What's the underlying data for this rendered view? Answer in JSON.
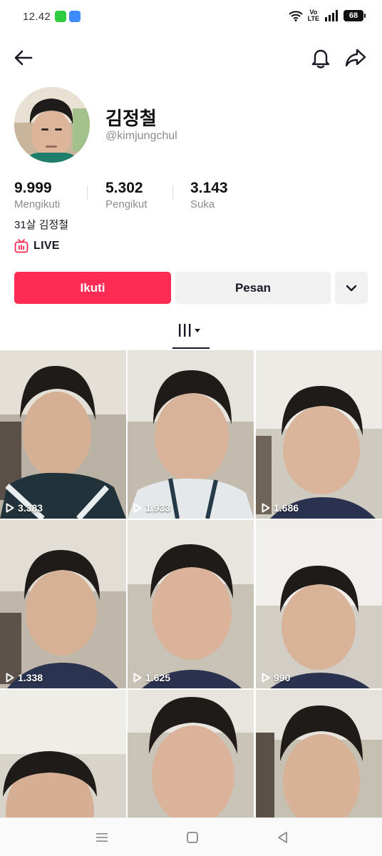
{
  "status_bar": {
    "time": "12.42",
    "network": "VoLTE",
    "battery": "68"
  },
  "profile": {
    "display_name": "김정철",
    "username": "@kimjungchul",
    "bio": "31살 김정철",
    "live_label": "LIVE"
  },
  "stats": {
    "following": {
      "value": "9.999",
      "label": "Mengikuti"
    },
    "followers": {
      "value": "5.302",
      "label": "Pengikut"
    },
    "likes": {
      "value": "3.143",
      "label": "Suka"
    }
  },
  "actions": {
    "follow_label": "Ikuti",
    "message_label": "Pesan"
  },
  "icons": {
    "back": "arrow-left-icon",
    "notifications": "bell-icon",
    "share": "share-arrow-icon",
    "live": "tv-icon",
    "more": "chevron-down-icon",
    "videos_tab": "grid-bars-icon",
    "play": "play-icon"
  },
  "colors": {
    "accent": "#fe2c55",
    "secondary_button": "#f1f1f2",
    "muted_text": "#8a8b91"
  },
  "videos": [
    {
      "views": "3.383"
    },
    {
      "views": "1.933"
    },
    {
      "views": "1.686"
    },
    {
      "views": "1.338"
    },
    {
      "views": "1.625"
    },
    {
      "views": "990"
    },
    {
      "views": ""
    },
    {
      "views": ""
    },
    {
      "views": ""
    }
  ]
}
